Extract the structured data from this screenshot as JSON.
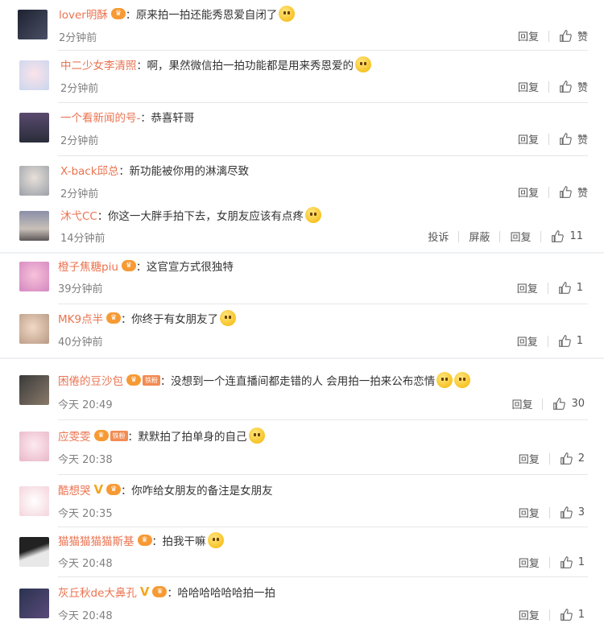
{
  "actions": {
    "reply": "回复",
    "like": "赞",
    "report": "投诉",
    "block": "屏蔽"
  },
  "badges": {
    "vip": "V",
    "fan": "铁粉"
  },
  "comments": [
    {
      "user": "lover明酥",
      "text": "原来拍一拍还能秀恩爱自闭了",
      "time": "2分钟前",
      "likes": "赞"
    },
    {
      "user": "中二少女李清照",
      "text": "啊，果然微信拍一拍功能都是用来秀恩爱的",
      "time": "2分钟前",
      "likes": "赞"
    },
    {
      "user": "一个看新闻的号-",
      "text": "恭喜轩哥",
      "time": "2分钟前",
      "likes": "赞"
    },
    {
      "user": "X-back邱总",
      "text": "新功能被你用的淋漓尽致",
      "time": "2分钟前",
      "likes": "赞"
    },
    {
      "user": "沐弋CC",
      "text": "你这一大胖手拍下去，女朋友应该有点疼",
      "time": "14分钟前",
      "likes": "11"
    },
    {
      "user": "橙子焦糖piu",
      "text": "这官宣方式很独特",
      "time": "39分钟前",
      "likes": "1"
    },
    {
      "user": "MK9点半",
      "text": "你终于有女朋友了",
      "time": "40分钟前",
      "likes": "1"
    },
    {
      "user": "困倦的豆沙包",
      "text": "没想到一个连直播间都走错的人 会用拍一拍来公布恋情",
      "time": "今天 20:49",
      "likes": "30"
    },
    {
      "user": "应雯雯",
      "text": "默默拍了拍单身的自己",
      "time": "今天 20:38",
      "likes": "2"
    },
    {
      "user": "酷想哭",
      "text": "你咋给女朋友的备注是女朋友",
      "time": "今天 20:35",
      "likes": "3"
    },
    {
      "user": "猫猫猫猫猫斯基",
      "text": "拍我干嘛",
      "time": "今天 20:48",
      "likes": "1"
    },
    {
      "user": "灰丘秋de大鼻孔",
      "text": "哈哈哈哈哈哈拍一拍",
      "time": "今天 20:48",
      "likes": "1"
    }
  ],
  "colors": {
    "username": "#eb7350",
    "time": "#808080",
    "vip": "#f79a34"
  },
  "icons": [
    "thumb-up-icon",
    "crown-badge-icon",
    "emoji-icon",
    "verified-v-icon"
  ]
}
